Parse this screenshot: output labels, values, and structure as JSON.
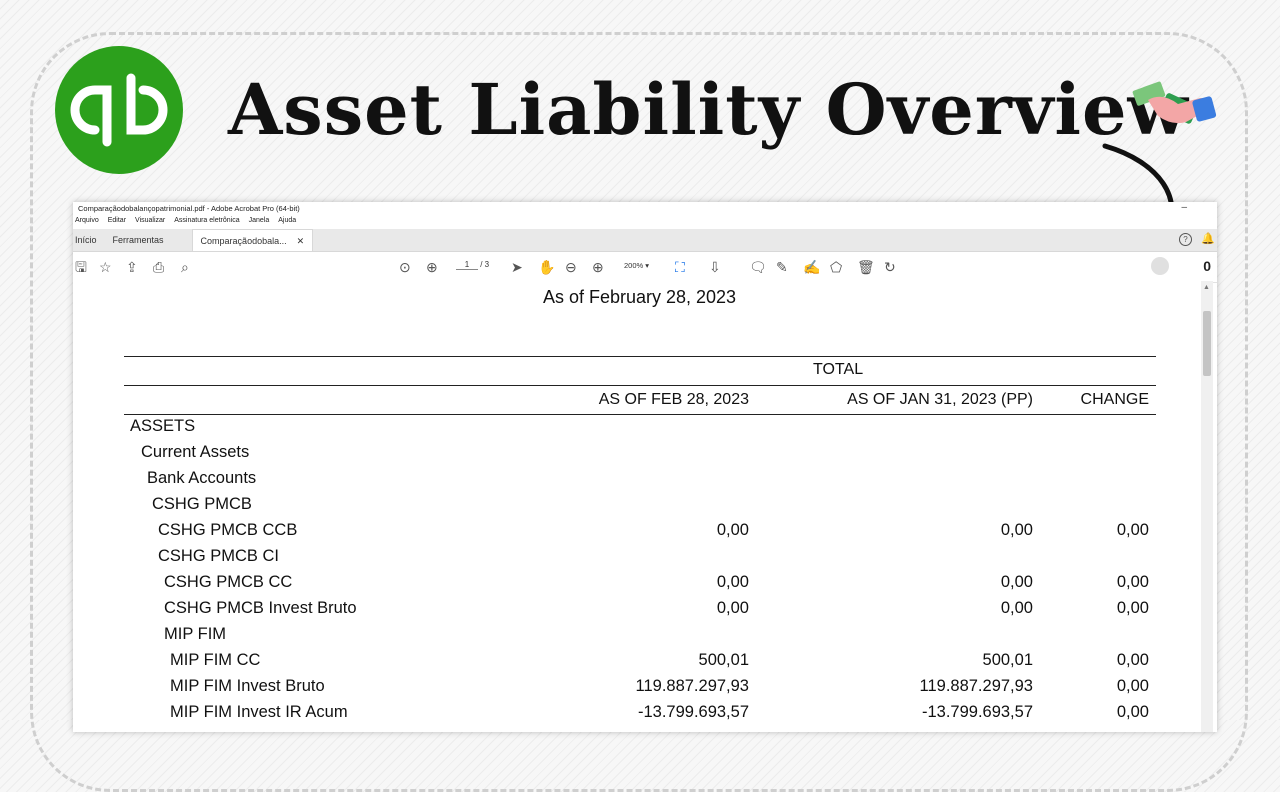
{
  "headline": "Asset Liability Overview",
  "brand": {
    "logo_color": "#2ca01c"
  },
  "acrobat": {
    "window_title": "Comparaçãodobalançopatrimonial.pdf - Adobe Acrobat Pro (64-bit)",
    "menu": [
      "Arquivo",
      "Editar",
      "Visualizar",
      "Assinatura eletrônica",
      "Janela",
      "Ajuda"
    ],
    "tabs": {
      "home": "Início",
      "tools": "Ferramentas",
      "document": "Comparaçãodobala..."
    },
    "page_current": "1",
    "page_total": "/ 3",
    "zoom": "200%",
    "notification_count": "0"
  },
  "report": {
    "subtitle": "As of February 28, 2023",
    "group_header": "TOTAL",
    "columns": [
      "AS OF FEB 28, 2023",
      "AS OF JAN 31, 2023 (PP)",
      "CHANGE"
    ],
    "rows": [
      {
        "label": "ASSETS",
        "v1": "",
        "v2": "",
        "v3": ""
      },
      {
        "label": "Current Assets",
        "v1": "",
        "v2": "",
        "v3": ""
      },
      {
        "label": "Bank Accounts",
        "v1": "",
        "v2": "",
        "v3": ""
      },
      {
        "label": "CSHG PMCB",
        "v1": "",
        "v2": "",
        "v3": ""
      },
      {
        "label": "CSHG PMCB CCB",
        "v1": "0,00",
        "v2": "0,00",
        "v3": "0,00"
      },
      {
        "label": "CSHG PMCB CI",
        "v1": "",
        "v2": "",
        "v3": ""
      },
      {
        "label": "CSHG PMCB CC",
        "v1": "0,00",
        "v2": "0,00",
        "v3": "0,00"
      },
      {
        "label": "CSHG PMCB Invest Bruto",
        "v1": "0,00",
        "v2": "0,00",
        "v3": "0,00"
      },
      {
        "label": "MIP FIM",
        "v1": "",
        "v2": "",
        "v3": ""
      },
      {
        "label": "MIP FIM CC",
        "v1": "500,01",
        "v2": "500,01",
        "v3": "0,00"
      },
      {
        "label": "MIP FIM Invest Bruto",
        "v1": "119.887.297,93",
        "v2": "119.887.297,93",
        "v3": "0,00"
      },
      {
        "label": "MIP FIM Invest IR Acum",
        "v1": "-13.799.693,57",
        "v2": "-13.799.693,57",
        "v3": "0,00"
      }
    ]
  }
}
